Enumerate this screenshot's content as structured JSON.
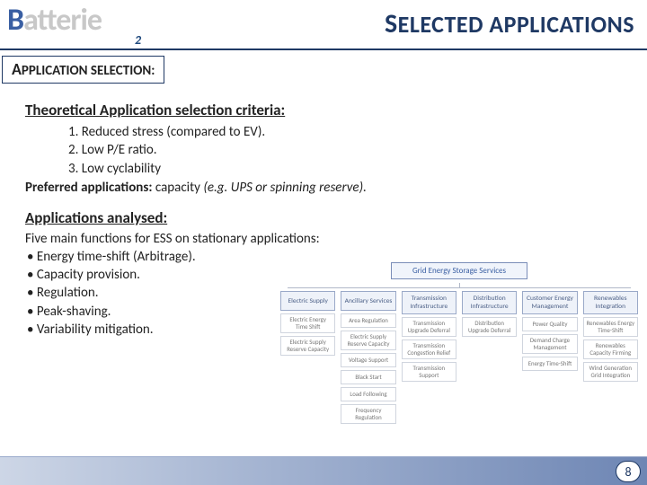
{
  "header": {
    "brand_b": "B",
    "brand_rest": "atterie",
    "brand_sub": "2",
    "title_lead": "S",
    "title_rest": "ELECTED APPLICATIONS"
  },
  "tag": {
    "lead": "A",
    "rest": "PPLICATION SELECTION:"
  },
  "section1": {
    "heading": "Theoretical Application selection criteria:",
    "criteria": [
      "1.  Reduced stress (compared to EV).",
      "2.  Low P/E ratio.",
      "3.  Low cyclability"
    ],
    "pref_label": "Preferred applications:",
    "pref_text": " capacity ",
    "pref_example": "(e.g. UPS or spinning reserve)."
  },
  "section2": {
    "heading": "Applications analysed:",
    "intro": "Five main functions for ESS on stationary applications:",
    "bullets": [
      "Energy time-shift (Arbitrage).",
      "Capacity provision.",
      "Regulation.",
      "Peak-shaving.",
      "Variability mitigation."
    ]
  },
  "diagram": {
    "root": "Grid Energy Storage Services",
    "columns": [
      {
        "head": "Electric Supply",
        "leaves": [
          "Electric Energy Time Shift",
          "Electric Supply Reserve Capacity"
        ]
      },
      {
        "head": "Ancillary Services",
        "leaves": [
          "Area Regulation",
          "Electric Supply Reserve Capacity",
          "Voltage Support",
          "Black Start",
          "Load Following",
          "Frequency Regulation"
        ]
      },
      {
        "head": "Transmission Infrastructure",
        "leaves": [
          "Transmission Upgrade Deferral",
          "Transmission Congestion Relief",
          "Transmission Support"
        ]
      },
      {
        "head": "Distribution Infrastructure",
        "leaves": [
          "Distribution Upgrade Deferral"
        ]
      },
      {
        "head": "Customer Energy Management",
        "leaves": [
          "Power Quality",
          "Demand Charge Management",
          "Energy Time-Shift"
        ]
      },
      {
        "head": "Renewables Integration",
        "leaves": [
          "Renewables Energy Time-Shift",
          "Renewables Capacity Firming",
          "Wind Generation Grid Integration"
        ]
      }
    ]
  },
  "page": "8"
}
